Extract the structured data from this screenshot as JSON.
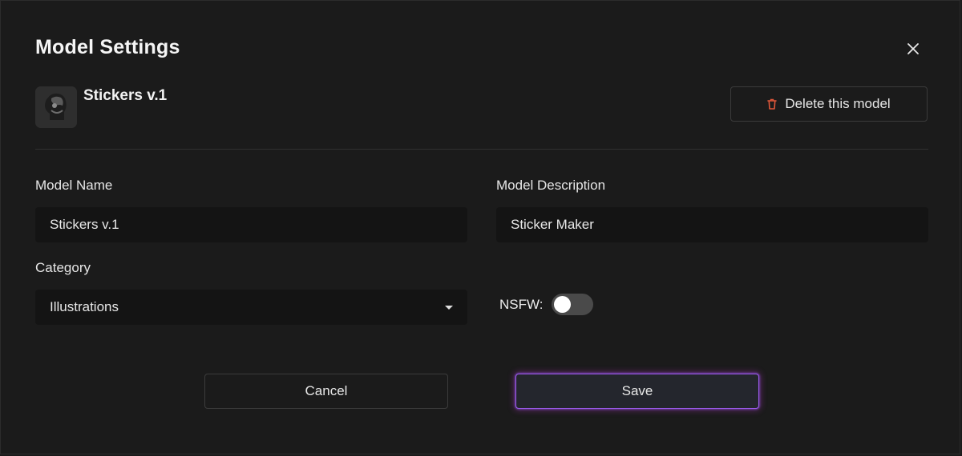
{
  "dialog": {
    "title": "Model Settings",
    "close_icon": "close-icon"
  },
  "model": {
    "name": "Stickers v.1",
    "thumbnail_icon": "model-thumbnail"
  },
  "delete_button": {
    "label": "Delete this model",
    "icon": "trash-icon",
    "icon_color": "#e0573a"
  },
  "form": {
    "name_label": "Model Name",
    "name_value": "Stickers v.1",
    "description_label": "Model Description",
    "description_value": "Sticker Maker",
    "category_label": "Category",
    "category_value": "Illustrations",
    "nsfw_label": "NSFW:",
    "nsfw_enabled": false
  },
  "actions": {
    "cancel_label": "Cancel",
    "save_label": "Save",
    "save_glow_color": "#9d5cf0"
  }
}
